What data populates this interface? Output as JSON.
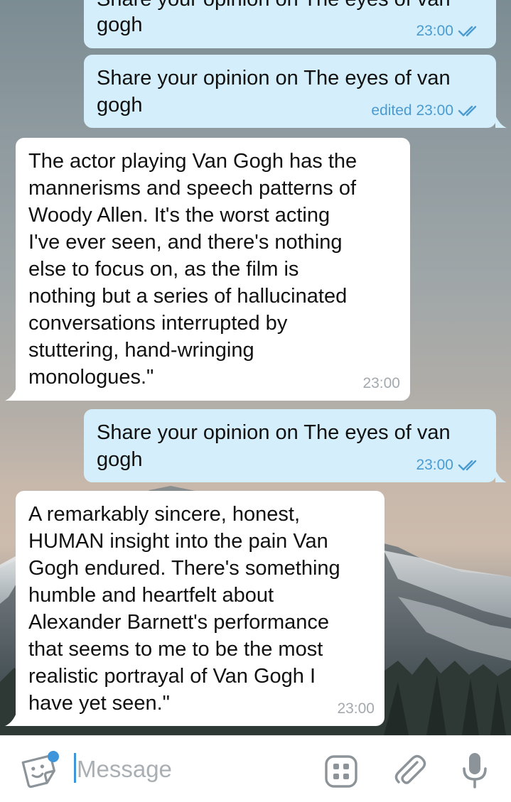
{
  "colors": {
    "outgoing_bubble": "#d4eefb",
    "incoming_bubble": "#ffffff",
    "outgoing_meta": "#4a9bd0",
    "incoming_meta": "#a3a9ad",
    "accent": "#3e95d9"
  },
  "messages": [
    {
      "direction": "outgoing",
      "text_partial_top": "Share your opinion on The eyes of van",
      "text": "gogh",
      "time": "23:00",
      "status_icon": "double-check-icon"
    },
    {
      "direction": "outgoing",
      "text": "Share your opinion on The eyes of van\ngogh",
      "time": "edited 23:00",
      "status_icon": "double-check-icon"
    },
    {
      "direction": "incoming",
      "text": "The actor playing Van Gogh has the\nmannerisms and speech patterns of\nWoody Allen. It's the worst acting\nI've ever seen, and there's nothing\nelse to focus on, as the film is\nnothing but a series of hallucinated\nconversations interrupted by\nstuttering, hand-wringing\nmonologues.\"",
      "time": "23:00"
    },
    {
      "direction": "outgoing",
      "text": "Share your opinion on The eyes of van\ngogh",
      "time": "23:00",
      "status_icon": "double-check-icon"
    },
    {
      "direction": "incoming",
      "text": "A remarkably sincere, honest,\nHUMAN insight into the pain Van\nGogh endured. There's something\nhumble and heartfelt about\nAlexander Barnett's performance\nthat seems to me to be the most\nrealistic portrayal of Van Gogh I\nhave yet seen.\"",
      "time": "23:00"
    }
  ],
  "input_bar": {
    "placeholder": "Message",
    "left_icon": "sticker-emoji-icon",
    "right_icons": [
      "bot-commands-icon",
      "paperclip-icon",
      "microphone-icon"
    ]
  }
}
